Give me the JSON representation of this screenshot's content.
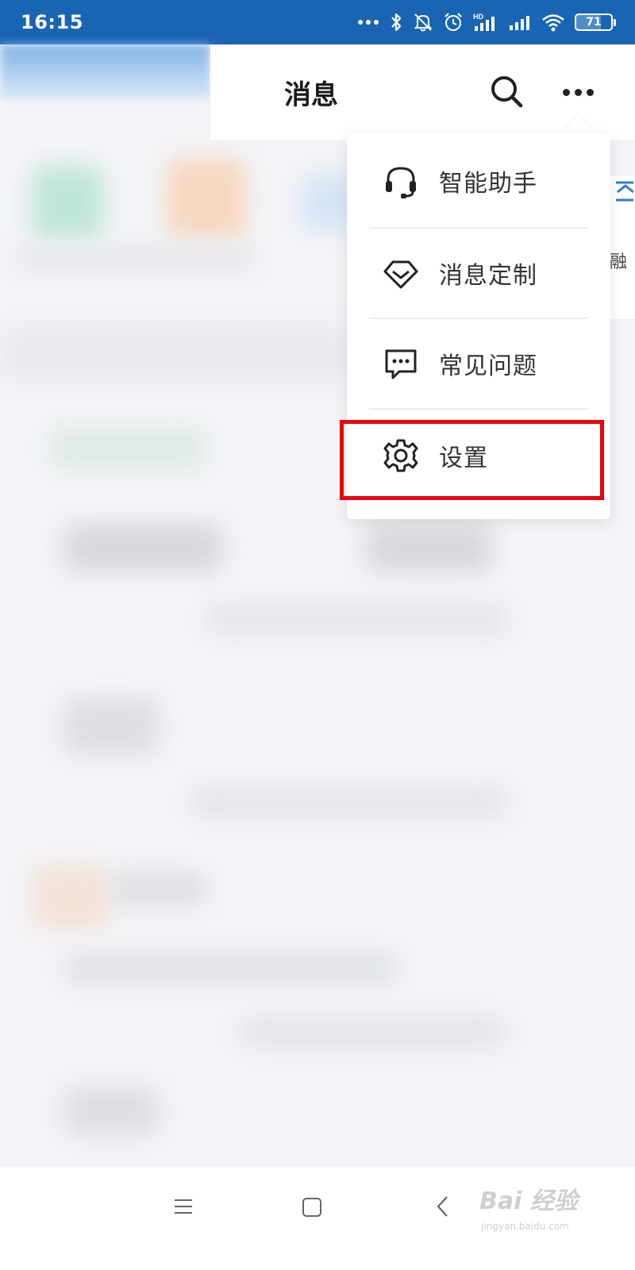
{
  "status_bar": {
    "time": "16:15",
    "battery": 71,
    "icons": [
      "more-dots-icon",
      "bluetooth-icon",
      "notifications-off-icon",
      "alarm-icon",
      "hd-signal-icon",
      "signal-icon",
      "wifi-icon",
      "battery-icon"
    ]
  },
  "header": {
    "title": "消息",
    "search_icon": "search-icon",
    "more_icon": "more-icon"
  },
  "menu": {
    "items": [
      {
        "label": "智能助手",
        "icon": "headset-icon"
      },
      {
        "label": "消息定制",
        "icon": "diamond-icon"
      },
      {
        "label": "常见问题",
        "icon": "chat-bubble-icon"
      },
      {
        "label": "设置",
        "icon": "gear-icon"
      }
    ],
    "highlighted_index": 3,
    "highlight_color": "#e8000b"
  },
  "edge_peek": {
    "text": "融"
  },
  "nav_bar": {
    "icons": [
      "menu-icon",
      "home-icon",
      "back-icon"
    ]
  },
  "watermark": {
    "main": "Bai 经验",
    "sub": "jingyan.baidu.com"
  },
  "colors": {
    "status_bar": "#1a64b4",
    "accent": "#1a64b4"
  }
}
